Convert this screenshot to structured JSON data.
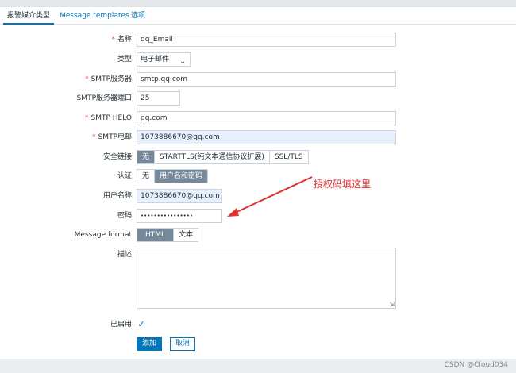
{
  "tabs": [
    "报警媒介类型",
    "Message templates",
    "选项"
  ],
  "form": {
    "name": {
      "label": "名称",
      "value": "qq_Email"
    },
    "type": {
      "label": "类型",
      "value": "电子邮件"
    },
    "smtp_server": {
      "label": "SMTP服务器",
      "value": "smtp.qq.com"
    },
    "smtp_port": {
      "label": "SMTP服务器端口",
      "value": "25"
    },
    "smtp_helo": {
      "label": "SMTP HELO",
      "value": "qq.com"
    },
    "smtp_email": {
      "label": "SMTP电邮",
      "value": "1073886670@qq.com"
    },
    "security": {
      "label": "安全链接",
      "options": [
        "无",
        "STARTTLS(纯文本通信协议扩展)",
        "SSL/TLS"
      ],
      "selected": "无"
    },
    "auth": {
      "label": "认证",
      "options": [
        "无",
        "用户名和密码"
      ],
      "selected": "用户名和密码"
    },
    "username": {
      "label": "用户名称",
      "value": "1073886670@qq.com"
    },
    "password": {
      "label": "密码",
      "value": "••••••••••••••••"
    },
    "message_format": {
      "label": "Message format",
      "options": [
        "HTML",
        "文本"
      ],
      "selected": "HTML"
    },
    "description": {
      "label": "描述",
      "value": ""
    },
    "enabled": {
      "label": "已启用",
      "checked": true
    }
  },
  "buttons": {
    "add": "添加",
    "cancel": "取消"
  },
  "annotation": "授权码填这里",
  "watermark": "CSDN @Cloud034",
  "colors": {
    "accent": "#0275b8",
    "annotation": "#e03131",
    "toggle_on": "#76899a",
    "required": "#d64e4e"
  },
  "icons": {
    "select": "chevron-down-icon",
    "checkbox": "checkmark-icon",
    "resize": "resize-grip-icon"
  }
}
